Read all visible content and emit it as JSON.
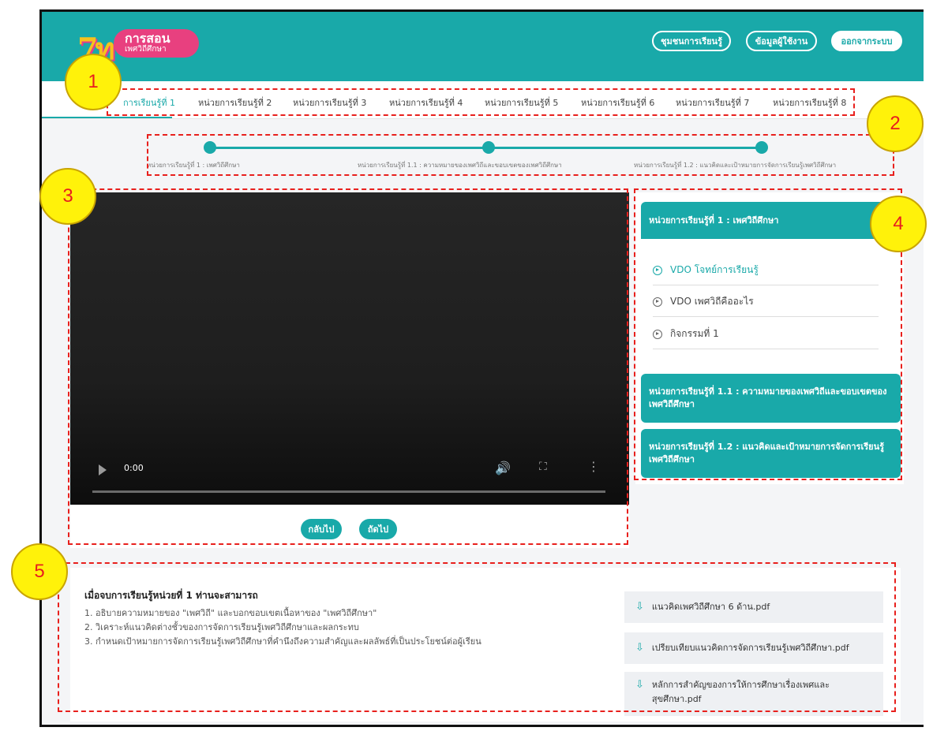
{
  "header": {
    "logo": {
      "mark": "7ท",
      "line1": "การสอน",
      "line2": "เพศวิถีศึกษา"
    },
    "buttons": {
      "community": "ชุมชนการเรียนรู้",
      "profile": "ข้อมูลผู้ใช้งาน",
      "logout": "ออกจากระบบ"
    }
  },
  "unit_tabs": [
    "การเรียนรู้ที่ 1",
    "หน่วยการเรียนรู้ที่ 2",
    "หน่วยการเรียนรู้ที่ 3",
    "หน่วยการเรียนรู้ที่ 4",
    "หน่วยการเรียนรู้ที่ 5",
    "หน่วยการเรียนรู้ที่ 6",
    "หน่วยการเรียนรู้ที่ 7",
    "หน่วยการเรียนรู้ที่ 8"
  ],
  "stepper": [
    "หน่วยการเรียนรู้ที่ 1 : เพศวิถีศึกษา",
    "หน่วยการเรียนรู้ที่ 1.1 : ความหมายของเพศวิถีและขอบเขตของเพศวิถีศึกษา",
    "หน่วยการเรียนรู้ที่ 1.2 : แนวคิดและเป้าหมายการจัดการเรียนรู้เพศวิถีศึกษา"
  ],
  "video": {
    "time": "0:00"
  },
  "nav": {
    "back": "กลับไป",
    "next": "ถัดไป"
  },
  "sidebar": {
    "section_1": "หน่วยการเรียนรู้ที่ 1 : เพศวิถีศึกษา",
    "lessons": [
      "VDO โจทย์การเรียนรู้",
      "VDO เพศวิถีคืออะไร",
      "กิจกรรมที่ 1"
    ],
    "section_2": "หน่วยการเรียนรู้ที่ 1.1 : ความหมายของเพศวิถีและขอบเขตของเพศวิถีศึกษา",
    "section_3": "หน่วยการเรียนรู้ที่ 1.2 : แนวคิดและเป้าหมายการจัดการเรียนรู้เพศวิถีศึกษา"
  },
  "objectives": {
    "title": "เมื่อจบการเรียนรู้หน่วยที่ 1 ท่านจะสามารถ",
    "items": [
      "1. อธิบายความหมายของ \"เพศวิถี\" และบอกขอบเขตเนื้อหาของ \"เพศวิถีศึกษา\"",
      "2. วิเคราะห์แนวคิดต่างชั้วของการจัดการเรียนรู้เพศวิถีศึกษาและผลกระทบ",
      "3. กำหนดเป้าหมายการจัดการเรียนรู้เพศวิถีศึกษาที่คำนึงถึงความสำคัญและผลลัพธ์ที่เป็นประโยชน์ต่อผู้เรียน"
    ]
  },
  "files": [
    "แนวคิดเพศวิถีศึกษา 6 ด้าน.pdf",
    "เปรียบเทียบแนวคิดการจัดการเรียนรู้เพศวิถีศึกษา.pdf",
    "หลักการสำคัญของการให้การศึกษาเรื่องเพศและสุขศึกษา.pdf"
  ],
  "markers": [
    "1",
    "2",
    "3",
    "4",
    "5"
  ],
  "colors": {
    "brand": "#19a9a9",
    "accent_pink": "#e8407f",
    "annotation": "#e8201d",
    "marker_fill": "#fff20a"
  }
}
